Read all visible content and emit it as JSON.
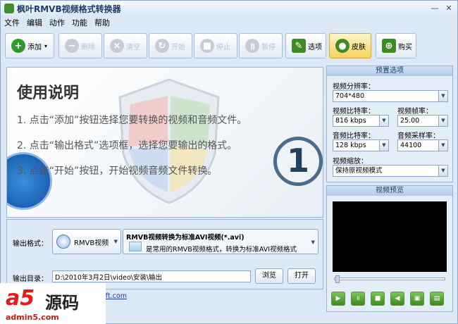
{
  "window": {
    "title": "枫叶RMVB视频格式转换器",
    "minimize": "—",
    "close": "✕"
  },
  "menu": [
    "文件",
    "编辑",
    "动作",
    "功能",
    "帮助"
  ],
  "toolbar": {
    "add": "添加",
    "add_caret": "▾",
    "delete": "删除",
    "clear": "清空",
    "start": "开始",
    "stop": "停止",
    "pause": "暂停",
    "options": "选项",
    "skin": "皮肤",
    "buy": "购买"
  },
  "guide": {
    "title": "使用说明",
    "steps": [
      "1. 点击“添加”按钮选择您要转换的视频和音频文件。",
      "2. 点击“输出格式”选项框，选择您要输出的格式。",
      "3. 点击“开始”按钮，开始视频音频文件转换。"
    ],
    "badge": "1"
  },
  "output": {
    "format_label": "输出格式：",
    "format_value": "RMVB视频",
    "format_title": "RMVB视频转换为标准AVI视频(*.avi)",
    "format_desc": "是常用的RMVB视频格式，转换为标准AVI视频格式",
    "dir_label": "输出目录：",
    "dir_value": "D:\\2010年3月2日\\video\\安装\\输出",
    "browse": "浏览",
    "open": "打开",
    "link_fragment": "soft.com"
  },
  "presets": {
    "title": "预置选项",
    "resolution_label": "视频分辨率：",
    "resolution": "704*480",
    "vbitrate_label": "视频比特率：",
    "vbitrate": "816 kbps",
    "fps_label": "视频帧率：",
    "fps": "25.00",
    "abitrate_label": "音频比特率：",
    "abitrate": "128 kbps",
    "samplerate_label": "音频采样率：",
    "samplerate": "44100",
    "scale_label": "视频缩放：",
    "scale": "保持原视频模式"
  },
  "preview": {
    "title": "视频预览"
  },
  "watermark": {
    "brand": "a5",
    "name": "源码",
    "url": "admin5.com"
  },
  "colors": {
    "accent": "#3e8b22",
    "frame": "#dce8f6",
    "watermark_red": "#e21b1b"
  }
}
